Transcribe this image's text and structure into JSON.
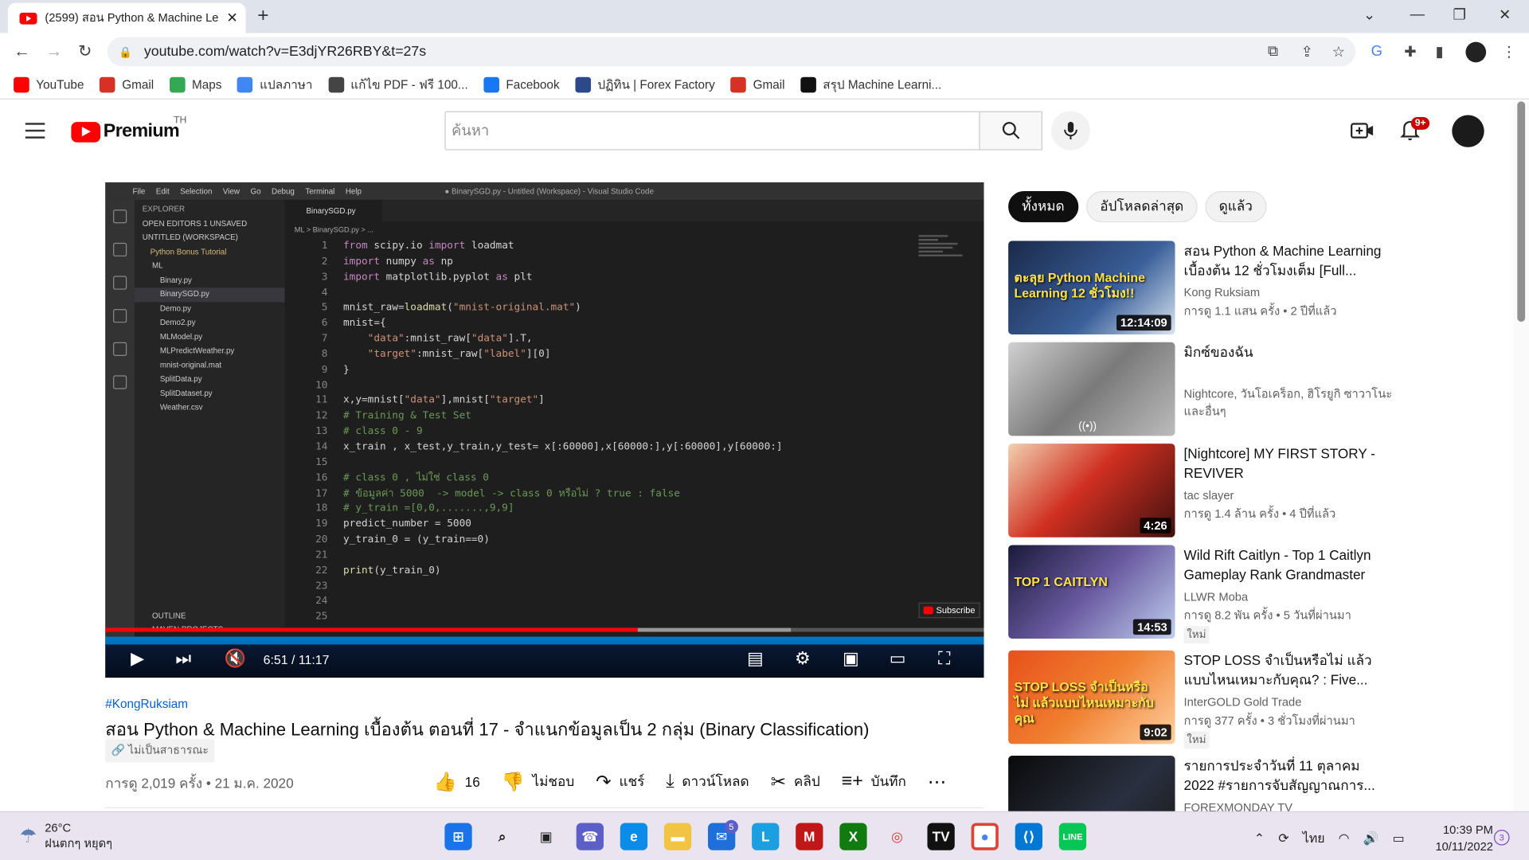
{
  "browser": {
    "tab_title": "(2599) สอน Python & Machine Le",
    "url": "youtube.com/watch?v=E3djYR26RBY&t=27s",
    "bookmarks": [
      {
        "label": "YouTube",
        "icon": "youtube-icon",
        "color": "#ff0000"
      },
      {
        "label": "Gmail",
        "icon": "gmail-icon",
        "color": "#d93025"
      },
      {
        "label": "Maps",
        "icon": "maps-icon",
        "color": "#34a853"
      },
      {
        "label": "แปลภาษา",
        "icon": "translate-icon",
        "color": "#4285f4"
      },
      {
        "label": "แก้ไข PDF - ฟรี 100...",
        "icon": "pdf-icon",
        "color": "#444444"
      },
      {
        "label": "Facebook",
        "icon": "facebook-icon",
        "color": "#1877f2"
      },
      {
        "label": "ปฏิทิน | Forex Factory",
        "icon": "forex-factory-icon",
        "color": "#2c4a8a"
      },
      {
        "label": "Gmail",
        "icon": "gmail-icon",
        "color": "#d93025"
      },
      {
        "label": "สรุป Machine Learni...",
        "icon": "medium-icon",
        "color": "#111111"
      }
    ]
  },
  "youtube": {
    "logo_text": "Premium",
    "region": "TH",
    "search_placeholder": "ค้นหา",
    "notification_count": "9+"
  },
  "player": {
    "time": "6:51 / 11:17",
    "progress": 0.606,
    "buffered": 0.78,
    "subscribe_watermark": "Subscribe",
    "vscode": {
      "menu": [
        "File",
        "Edit",
        "Selection",
        "View",
        "Go",
        "Debug",
        "Terminal",
        "Help"
      ],
      "window_title": "● BinarySGD.py - Untitled (Workspace) - Visual Studio Code",
      "explorer_header": "EXPLORER",
      "explorer_rows": [
        "OPEN EDITORS   1 UNSAVED",
        "UNTITLED (WORKSPACE)",
        "Python Bonus Tutorial",
        "ML",
        "Binary.py",
        "BinarySGD.py",
        "Demo.py",
        "Demo2.py",
        "MLModel.py",
        "MLPredictWeather.py",
        "mnist-original.mat",
        "SplitData.py",
        "SplitDataset.py",
        "Weather.csv"
      ],
      "outline": "OUTLINE",
      "maven": "MAVEN PROJECTS",
      "tab": "BinarySGD.py",
      "breadcrumb": "ML > BinarySGD.py > ...",
      "code": [
        "from scipy.io import loadmat",
        "import numpy as np",
        "import matplotlib.pyplot as plt",
        "",
        "mnist_raw=loadmat(\"mnist-original.mat\")",
        "mnist={",
        "    \"data\":mnist_raw[\"data\"].T,",
        "    \"target\":mnist_raw[\"label\"][0]",
        "}",
        "",
        "x,y=mnist[\"data\"],mnist[\"target\"]",
        "# Training & Test Set",
        "# class 0 - 9",
        "x_train , x_test,y_train,y_test= x[:60000],x[60000:],y[:60000],y[60000:]",
        "",
        "# class 0 , ไม่ใช่ class 0",
        "# ข้อมูลค่า 5000  -> model -> class 0 หรือไม่ ? true : false",
        "# y_train =[0,0,.......,9,9]",
        "predict_number = 5000",
        "y_train_0 = (y_train==0)",
        "",
        "print(y_train_0)",
        "",
        "",
        ""
      ]
    }
  },
  "video": {
    "hashtag": "#KongRuksiam",
    "title": "สอน Python & Machine Learning เบื้องต้น ตอนที่ 17 - จำแนกข้อมูลเป็น 2 กลุ่ม (Binary Classification)",
    "visibility": "ไม่เป็นสาธารณะ",
    "meta": "การดู 2,019 ครั้ง • 21 ม.ค. 2020",
    "actions": {
      "like_count": "16",
      "dislike": "ไม่ชอบ",
      "share": "แชร์",
      "download": "ดาวน์โหลด",
      "clip": "คลิป",
      "save": "บันทึก"
    }
  },
  "chips": [
    "ทั้งหมด",
    "อัปโหลดล่าสุด",
    "ดูแล้ว"
  ],
  "recommendations": [
    {
      "title": "สอน Python & Machine Learning เบื้องต้น 12 ชั่วโมงเต็ม [Full...",
      "channel": "Kong Ruksiam",
      "meta": "การดู 1.1 แสน ครั้ง • 2 ปีที่แล้ว",
      "duration": "12:14:09",
      "thumb_text": "ตะลุย Python Machine Learning 12 ชั่วโมง!!",
      "new": ""
    },
    {
      "title": "มิกซ์ของฉัน",
      "channel": "Nightcore, วันโอเคร็อก, ฮิโรยูกิ ซาวาโนะ และอื่นๆ",
      "meta": "",
      "duration": "",
      "thumb_text": "",
      "new": ""
    },
    {
      "title": "[Nightcore] MY FIRST STORY - REVIVER",
      "channel": "tac slayer",
      "meta": "การดู 1.4 ล้าน ครั้ง • 4 ปีที่แล้ว",
      "duration": "4:26",
      "thumb_text": "",
      "new": ""
    },
    {
      "title": "Wild Rift Caitlyn - Top 1 Caitlyn Gameplay Rank Grandmaster",
      "channel": "LLWR Moba",
      "meta": "การดู 8.2 พัน ครั้ง • 5 วันที่ผ่านมา",
      "duration": "14:53",
      "thumb_text": "TOP 1 CAITLYN",
      "new": "ใหม่"
    },
    {
      "title": "STOP LOSS จำเป็นหรือไม่ แล้วแบบไหนเหมาะกับคุณ? : Five...",
      "channel": "InterGOLD Gold Trade",
      "meta": "การดู 377 ครั้ง • 3 ชั่วโมงที่ผ่านมา",
      "duration": "9:02",
      "thumb_text": "STOP LOSS จำเป็นหรือไม่ แล้วแบบไหนเหมาะกับคุณ",
      "new": "ใหม่"
    },
    {
      "title": "รายการประจำวันที่ 11 ตุลาคม 2022 #รายการจับสัญญาณการ...",
      "channel": "FOREXMONDAY TV",
      "meta": "",
      "duration": "",
      "thumb_text": "",
      "new": ""
    }
  ],
  "taskbar": {
    "temperature": "26°C",
    "weather": "ฝนตกๆ หยุดๆ",
    "mail_badge": "5",
    "language": "ไทย",
    "time": "10:39 PM",
    "date": "10/11/2022",
    "notifications": "3"
  }
}
